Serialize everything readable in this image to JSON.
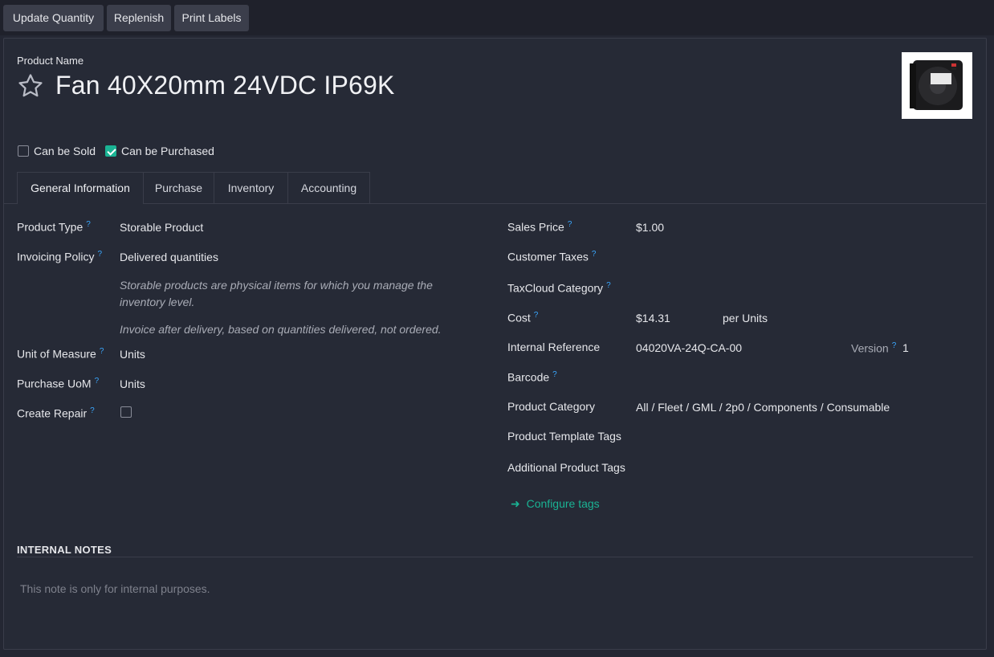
{
  "toolbar": {
    "update_quantity": "Update Quantity",
    "replenish": "Replenish",
    "print_labels": "Print Labels"
  },
  "product": {
    "name_label": "Product Name",
    "name": "Fan 40X20mm 24VDC IP69K",
    "image_icon": "product-fan-image"
  },
  "options": {
    "can_be_sold": {
      "label": "Can be Sold",
      "checked": false
    },
    "can_be_purchased": {
      "label": "Can be Purchased",
      "checked": true
    }
  },
  "tabs": [
    {
      "label": "General Information",
      "active": true
    },
    {
      "label": "Purchase",
      "active": false
    },
    {
      "label": "Inventory",
      "active": false
    },
    {
      "label": "Accounting",
      "active": false
    }
  ],
  "left": {
    "product_type": {
      "label": "Product Type",
      "value": "Storable Product"
    },
    "invoicing_policy": {
      "label": "Invoicing Policy",
      "value": "Delivered quantities"
    },
    "help_storable": "Storable products are physical items for which you manage the inventory level.",
    "help_invoice": "Invoice after delivery, based on quantities delivered, not ordered.",
    "unit_of_measure": {
      "label": "Unit of Measure",
      "value": "Units"
    },
    "purchase_uom": {
      "label": "Purchase UoM",
      "value": "Units"
    },
    "create_repair": {
      "label": "Create Repair",
      "checked": false
    }
  },
  "right": {
    "sales_price": {
      "label": "Sales Price",
      "value": "$1.00"
    },
    "customer_taxes": {
      "label": "Customer Taxes"
    },
    "taxcloud_category": {
      "label": "TaxCloud Category"
    },
    "cost": {
      "label": "Cost",
      "value": "$14.31",
      "unit": "per Units"
    },
    "internal_reference": {
      "label": "Internal Reference",
      "value": "04020VA-24Q-CA-00"
    },
    "version": {
      "label": "Version",
      "value": "1"
    },
    "barcode": {
      "label": "Barcode"
    },
    "product_category": {
      "label": "Product Category",
      "value": "All / Fleet / GML / 2p0 / Components / Consumable"
    },
    "product_template_tags": {
      "label": "Product Template Tags"
    },
    "additional_product_tags": {
      "label": "Additional Product Tags"
    },
    "configure_tags": "Configure tags"
  },
  "notes": {
    "title": "INTERNAL NOTES",
    "placeholder": "This note is only for internal purposes."
  },
  "colors": {
    "accent": "#1ab394",
    "help_marker": "#3aa8ff",
    "background": "#242733"
  }
}
